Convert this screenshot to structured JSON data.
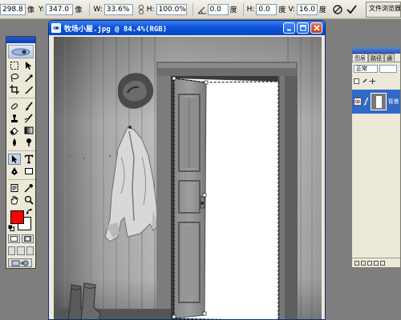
{
  "options_bar": {
    "x_value": "298.8",
    "x_unit": "像",
    "y_label": "Y:",
    "y_value": "347.0",
    "y_unit": "像",
    "w_label": "W:",
    "w_value": "33.6%",
    "h_label": "H:",
    "h_value": "100.0%",
    "angle_value": "0.0",
    "angle_unit": "度",
    "hskew_label": "H:",
    "hskew_value": "0.0",
    "hskew_unit": "度",
    "vskew_label": "V:",
    "vskew_value": "16.0",
    "vskew_unit": "度",
    "palette_well": "文件浏览器"
  },
  "document": {
    "title": "牧场小屋.jpg @ 84.4%(RGB)"
  },
  "layers_panel": {
    "tabs": [
      "图层",
      "路径",
      "通"
    ],
    "blend_mode": "正常",
    "layer_name": "背景"
  },
  "colors": {
    "foreground": "#ff0000",
    "background": "#ffffff",
    "title_bar": "#0b55d8"
  },
  "icons": [
    "cancel-icon",
    "commit-check-icon",
    "link-icon",
    "angle-icon",
    "photoshop-eye-icon",
    "eye-icon",
    "brush-icon"
  ]
}
